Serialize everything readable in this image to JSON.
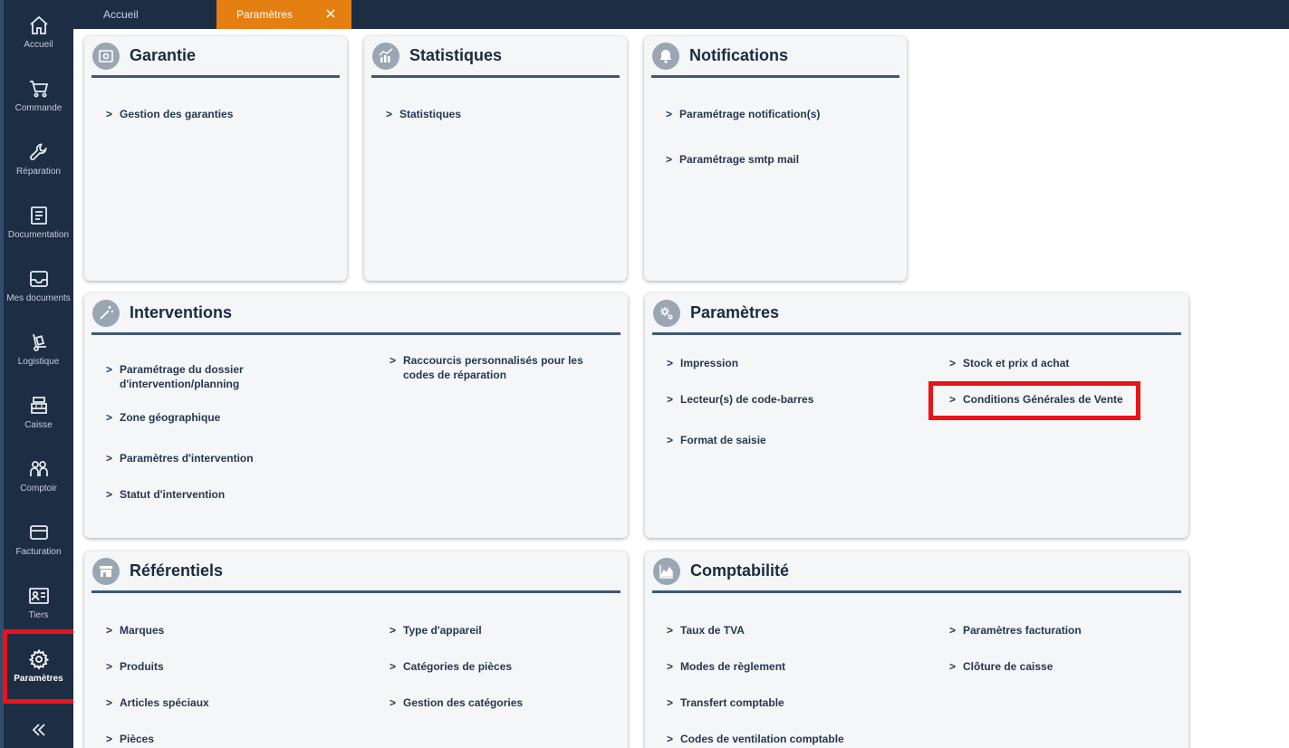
{
  "sidebar": {
    "items": [
      {
        "label": "Accueil",
        "icon": "home-icon"
      },
      {
        "label": "Commande",
        "icon": "cart-icon"
      },
      {
        "label": "Réparation",
        "icon": "wrench-icon"
      },
      {
        "label": "Documentation",
        "icon": "document-icon"
      },
      {
        "label": "Mes documents",
        "icon": "inbox-icon"
      },
      {
        "label": "Logistique",
        "icon": "hand-truck-icon"
      },
      {
        "label": "Caisse",
        "icon": "cash-register-icon"
      },
      {
        "label": "Comptoir",
        "icon": "people-icon"
      },
      {
        "label": "Facturation",
        "icon": "card-icon"
      },
      {
        "label": "Tiers",
        "icon": "id-card-icon"
      },
      {
        "label": "Paramètres",
        "icon": "gear-icon"
      }
    ],
    "collapse_icon": "double-chevron-left-icon"
  },
  "tabs": {
    "home_label": "Accueil",
    "active_label": "Paramètres"
  },
  "colors": {
    "sidebar_bg": "#1d2d44",
    "active_tab": "#e57f12",
    "highlight": "#e8141a",
    "card_bg": "#f5f6f8",
    "divider": "#3e5878"
  },
  "cards": {
    "garantie": {
      "title": "Garantie",
      "icon": "safe-icon",
      "links": [
        "Gestion des garanties"
      ]
    },
    "statistiques": {
      "title": "Statistiques",
      "icon": "chart-icon",
      "links": [
        "Statistiques"
      ]
    },
    "notifications": {
      "title": "Notifications",
      "icon": "bell-icon",
      "links": [
        "Paramétrage notification(s)",
        "Paramétrage smtp mail"
      ]
    },
    "interventions": {
      "title": "Interventions",
      "icon": "magic-wand-icon",
      "links": [
        "Paramétrage du dossier d'intervention/planning",
        "Zone géographique",
        "Paramètres d'intervention",
        "Statut d'intervention",
        "Raccourcis personnalisés pour les codes de réparation"
      ]
    },
    "parametres": {
      "title": "Paramètres",
      "icon": "gears-icon",
      "links": [
        "Impression",
        "Lecteur(s) de code-barres",
        "Format de saisie",
        "Stock et prix d achat",
        "Conditions Générales de Vente"
      ]
    },
    "referentiels": {
      "title": "Référentiels",
      "icon": "store-icon",
      "links": [
        "Marques",
        "Produits",
        "Articles spéciaux",
        "Pièces",
        "Type d'appareil",
        "Catégories de pièces",
        "Gestion des catégories"
      ]
    },
    "comptabilite": {
      "title": "Comptabilité",
      "icon": "area-chart-icon",
      "links": [
        "Taux de TVA",
        "Modes de règlement",
        "Transfert comptable",
        "Codes de ventilation comptable",
        "Paramètres facturation",
        "Clôture de caisse"
      ]
    }
  }
}
